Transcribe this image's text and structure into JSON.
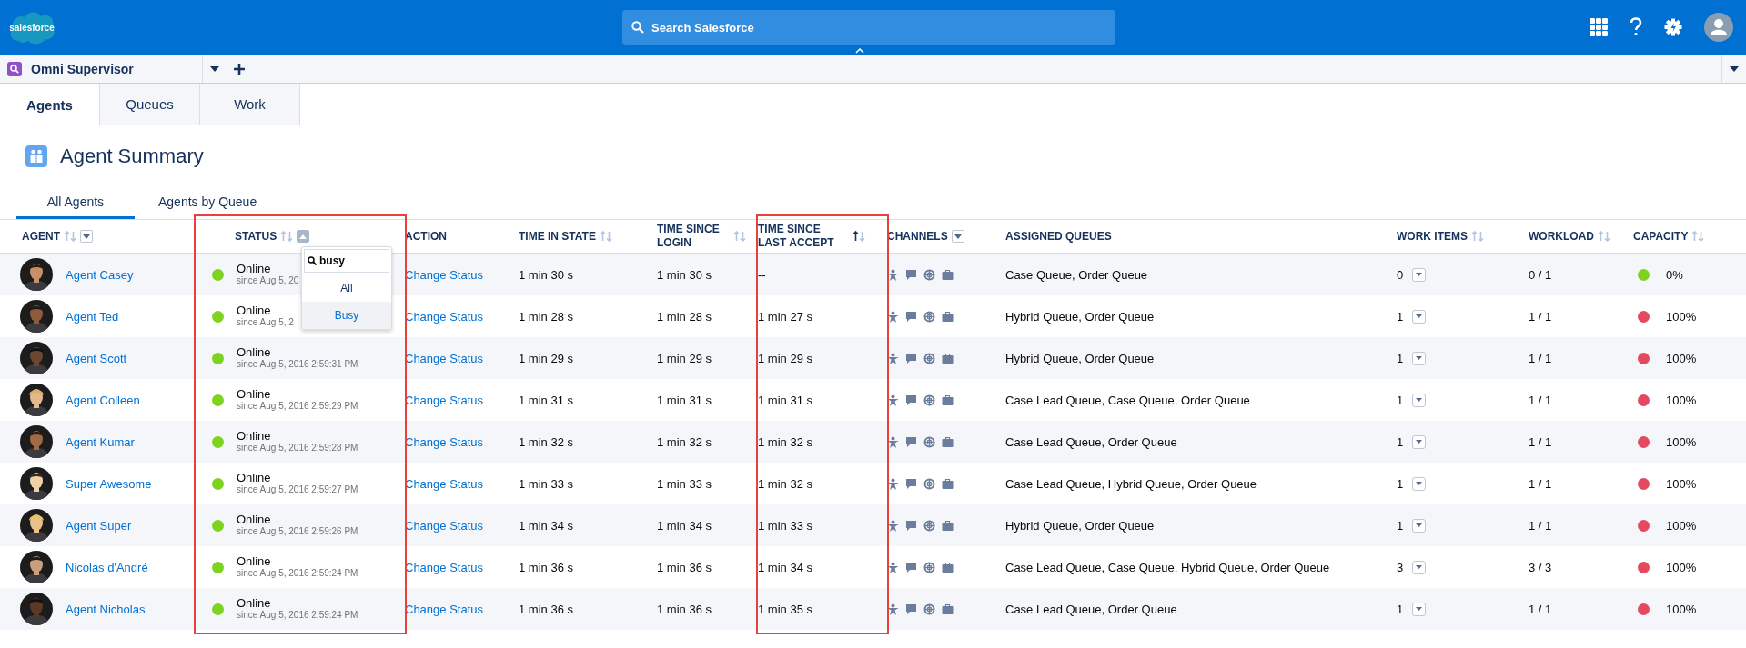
{
  "header": {
    "logo": "salesforce",
    "search": {
      "placeholder": "Search Salesforce"
    }
  },
  "nav": {
    "app_name": "Omni Supervisor"
  },
  "tabs": [
    {
      "label": "Agents",
      "selected": true
    },
    {
      "label": "Queues",
      "selected": false
    },
    {
      "label": "Work",
      "selected": false
    }
  ],
  "page": {
    "title": "Agent Summary"
  },
  "subtabs": [
    {
      "label": "All Agents",
      "selected": true
    },
    {
      "label": "Agents by Queue",
      "selected": false
    }
  ],
  "table": {
    "columns": [
      {
        "label": "AGENT",
        "sortable": true,
        "sorted": false,
        "filterable": true,
        "filter_open": false,
        "highlighted": false
      },
      {
        "label": "STATUS",
        "sortable": true,
        "sorted": false,
        "filterable": true,
        "filter_open": true,
        "highlighted": true
      },
      {
        "label": "ACTION",
        "sortable": false,
        "filterable": false,
        "highlighted": false
      },
      {
        "label": "TIME IN STATE",
        "sortable": true,
        "sorted": false,
        "filterable": false,
        "highlighted": false
      },
      {
        "label": "TIME SINCE LOGIN",
        "sortable": true,
        "sorted": false,
        "filterable": false,
        "highlighted": false
      },
      {
        "label": "TIME SINCE LAST ACCEPT",
        "sortable": true,
        "sorted": true,
        "filterable": false,
        "highlighted": true
      },
      {
        "label": "CHANNELS",
        "sortable": false,
        "filterable": true,
        "filter_open": false,
        "highlighted": false
      },
      {
        "label": "ASSIGNED QUEUES",
        "sortable": false,
        "filterable": false,
        "highlighted": false
      },
      {
        "label": "WORK ITEMS",
        "sortable": true,
        "sorted": false,
        "filterable": false,
        "highlighted": false
      },
      {
        "label": "WORKLOAD",
        "sortable": true,
        "sorted": false,
        "filterable": false,
        "highlighted": false
      },
      {
        "label": "CAPACITY",
        "sortable": true,
        "sorted": false,
        "filterable": false,
        "highlighted": false
      }
    ],
    "status_filter": {
      "value": "busy",
      "options": [
        {
          "label": "All",
          "selected": false
        },
        {
          "label": "Busy",
          "selected": true
        }
      ]
    },
    "rows": [
      {
        "agent": "Agent Casey",
        "status": "Online",
        "since": "since  Aug 5, 20",
        "action": "Change Status",
        "time_in_state": "1 min 30 s",
        "time_since_login": "1 min 30 s",
        "time_since_last_accept": "--",
        "assigned_queues": "Case Queue, Order Queue",
        "work_items": "0",
        "workload": "0 / 1",
        "capacity": "0%",
        "color": "#7ed321"
      },
      {
        "agent": "Agent Ted",
        "status": "Online",
        "since": "since  Aug 5, 2",
        "action": "Change Status",
        "time_in_state": "1 min 28 s",
        "time_since_login": "1 min 28 s",
        "time_since_last_accept": "1 min 27 s",
        "assigned_queues": "Hybrid Queue, Order Queue",
        "work_items": "1",
        "workload": "1 / 1",
        "capacity": "100%",
        "color": "#e4495f"
      },
      {
        "agent": "Agent Scott",
        "status": "Online",
        "since": "since  Aug 5, 2016 2:59:31 PM",
        "action": "Change Status",
        "time_in_state": "1 min 29 s",
        "time_since_login": "1 min 29 s",
        "time_since_last_accept": "1 min 29 s",
        "assigned_queues": "Hybrid Queue, Order Queue",
        "work_items": "1",
        "workload": "1 / 1",
        "capacity": "100%",
        "color": "#e4495f"
      },
      {
        "agent": "Agent Colleen",
        "status": "Online",
        "since": "since  Aug 5, 2016 2:59:29 PM",
        "action": "Change Status",
        "time_in_state": "1 min 31 s",
        "time_since_login": "1 min 31 s",
        "time_since_last_accept": "1 min 31 s",
        "assigned_queues": "Case Lead Queue, Case Queue, Order Queue",
        "work_items": "1",
        "workload": "1 / 1",
        "capacity": "100%",
        "color": "#e4495f"
      },
      {
        "agent": "Agent Kumar",
        "status": "Online",
        "since": "since  Aug 5, 2016 2:59:28 PM",
        "action": "Change Status",
        "time_in_state": "1 min 32 s",
        "time_since_login": "1 min 32 s",
        "time_since_last_accept": "1 min 32 s",
        "assigned_queues": "Case Lead Queue, Order Queue",
        "work_items": "1",
        "workload": "1 / 1",
        "capacity": "100%",
        "color": "#e4495f"
      },
      {
        "agent": "Super Awesome",
        "status": "Online",
        "since": "since  Aug 5, 2016 2:59:27 PM",
        "action": "Change Status",
        "time_in_state": "1 min 33 s",
        "time_since_login": "1 min 33 s",
        "time_since_last_accept": "1 min 32 s",
        "assigned_queues": "Case Lead Queue, Hybrid Queue, Order Queue",
        "work_items": "1",
        "workload": "1 / 1",
        "capacity": "100%",
        "color": "#e4495f"
      },
      {
        "agent": "Agent Super",
        "status": "Online",
        "since": "since  Aug 5, 2016 2:59:26 PM",
        "action": "Change Status",
        "time_in_state": "1 min 34 s",
        "time_since_login": "1 min 34 s",
        "time_since_last_accept": "1 min 33 s",
        "assigned_queues": "Hybrid Queue, Order Queue",
        "work_items": "1",
        "workload": "1 / 1",
        "capacity": "100%",
        "color": "#e4495f"
      },
      {
        "agent": "Nicolas d'André",
        "status": "Online",
        "since": "since  Aug 5, 2016 2:59:24 PM",
        "action": "Change Status",
        "time_in_state": "1 min 36 s",
        "time_since_login": "1 min 36 s",
        "time_since_last_accept": "1 min 34 s",
        "assigned_queues": "Case Lead Queue, Case Queue, Hybrid Queue, Order Queue",
        "work_items": "3",
        "workload": "3 / 3",
        "capacity": "100%",
        "color": "#e4495f"
      },
      {
        "agent": "Agent Nicholas",
        "status": "Online",
        "since": "since  Aug 5, 2016 2:59:24 PM",
        "action": "Change Status",
        "time_in_state": "1 min 36 s",
        "time_since_login": "1 min 36 s",
        "time_since_last_accept": "1 min 35 s",
        "assigned_queues": "Case Lead Queue, Order Queue",
        "work_items": "1",
        "workload": "1 / 1",
        "capacity": "100%",
        "color": "#e4495f"
      }
    ]
  }
}
